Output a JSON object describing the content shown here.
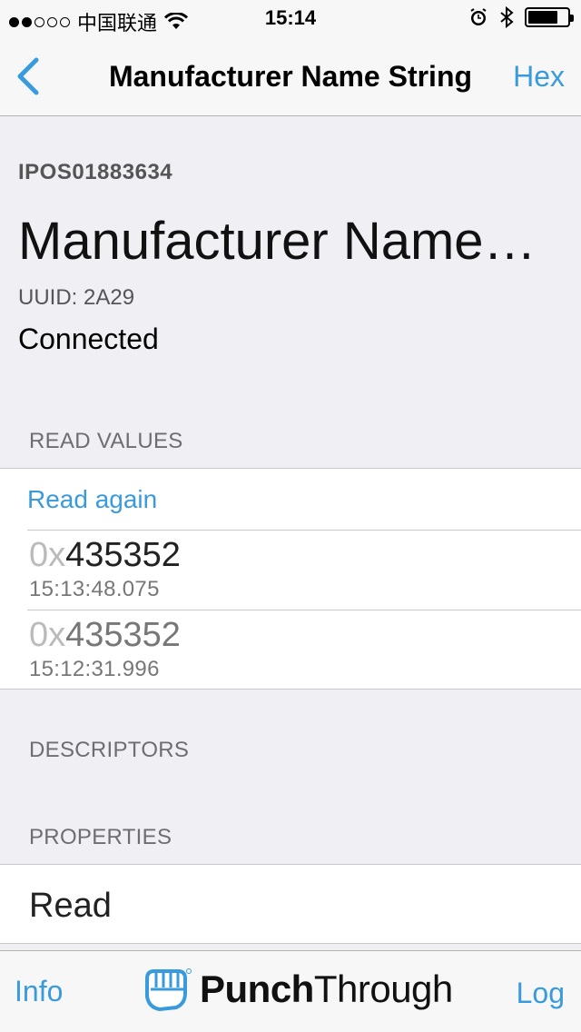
{
  "status_bar": {
    "carrier": "中国联通",
    "time": "15:14"
  },
  "nav": {
    "title": "Manufacturer Name String",
    "right_action": "Hex",
    "back_icon": "chevron-left-icon"
  },
  "header": {
    "device_id": "IPOS01883634",
    "characteristic_name": "Manufacturer Name…",
    "uuid": "UUID: 2A29",
    "status": "Connected"
  },
  "read_values": {
    "section_title": "READ VALUES",
    "read_again_label": "Read again",
    "values": [
      {
        "prefix": "0x",
        "value": "435352",
        "timestamp": "15:13:48.075"
      },
      {
        "prefix": "0x",
        "value": "435352",
        "timestamp": "15:12:31.996"
      }
    ]
  },
  "descriptors": {
    "section_title": "DESCRIPTORS"
  },
  "properties": {
    "section_title": "PROPERTIES",
    "items": [
      "Read"
    ]
  },
  "tab_bar": {
    "left": "Info",
    "brand_bold": "Punch",
    "brand_regular": "Through",
    "right": "Log"
  },
  "colors": {
    "accent": "#3a9bdc",
    "background": "#efeff4"
  }
}
